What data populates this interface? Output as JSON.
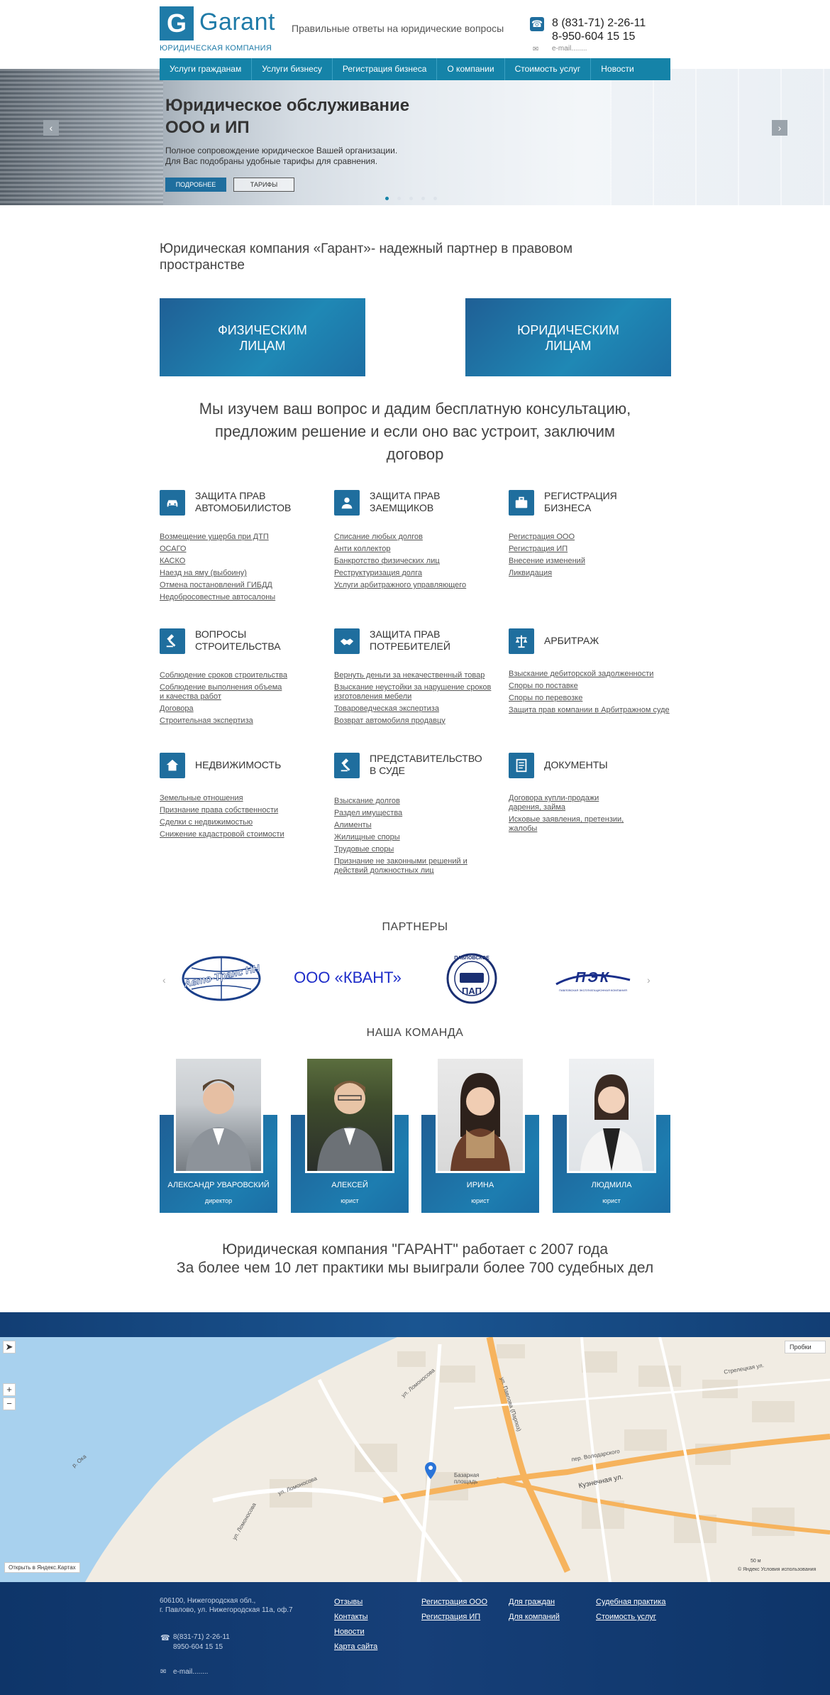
{
  "header": {
    "logo_letter": "G",
    "logo_word": "Garant",
    "logo_sub": "ЮРИДИЧЕСКАЯ КОМПАНИЯ",
    "tagline": "Правильные ответы на юридические вопросы",
    "phone_icon": "phone-icon",
    "phone1": "8 (831-71) 2-26-11",
    "phone2": "8-950-604 15 15",
    "mail_icon": "mail-icon",
    "email": "e-mail........"
  },
  "nav": [
    "Услуги гражданам",
    "Услуги бизнесу",
    "Регистрация бизнеса",
    "О компании",
    "Стоимость услуг",
    "Новости"
  ],
  "hero": {
    "title_line1": "Юридическое обслуживание",
    "title_line2": "ООО и ИП",
    "desc_line1": "Полное сопровождение юридическое Вашей организации.",
    "desc_line2": "Для Вас подобраны удобные тарифы для сравнения.",
    "btn_more": "ПОДРОБНЕЕ",
    "btn_tariffs": "ТАРИФЫ",
    "prev_icon": "‹",
    "next_icon": "›"
  },
  "intro": "Юридическая компания «Гарант»- надежный партнер в правовом пространстве",
  "big_buttons": {
    "individuals_line1": "ФИЗИЧЕСКИМ",
    "individuals_line2": "ЛИЦАМ",
    "legal_line1": "ЮРИДИЧЕСКИМ",
    "legal_line2": "ЛИЦАМ"
  },
  "consult": {
    "line1": "Мы изучем ваш вопрос и дадим бесплатную консультацию,",
    "line2": "предложим решение и если оно вас устроит, заключим",
    "line3": "договор"
  },
  "services": [
    {
      "icon": "car-icon",
      "title_line1": "ЗАЩИТА ПРАВ",
      "title_line2": "АВТОМОБИЛИСТОВ",
      "links": [
        "Возмещение ущерба при ДТП",
        "ОСАГО",
        "КАСКО",
        "Наезд на яму (выбоину)",
        "Отмена постановлений ГИБДД",
        "Недобросовестные автосалоны"
      ]
    },
    {
      "icon": "borrower-icon",
      "title_line1": "ЗАЩИТА ПРАВ",
      "title_line2": "ЗАЕМЩИКОВ",
      "links": [
        "Списание любых долгов",
        "Анти коллектор",
        "Банкротство физических лиц",
        "Реструктуризация долга",
        "Услуги арбитражного управляющего"
      ]
    },
    {
      "icon": "briefcase-icon",
      "title_line1": "РЕГИСТРАЦИЯ",
      "title_line2": "БИЗНЕСА",
      "links": [
        "Регистрация ООО",
        "Регистрация ИП",
        "Внесение изменений",
        "Ликвидация"
      ]
    },
    {
      "icon": "hammer-icon",
      "title_line1": "ВОПРОСЫ",
      "title_line2": "СТРОИТЕЛЬСТВА",
      "links": [
        "Соблюдение сроков строительства",
        "Соблюдение выполнения объема",
        "и качества работ",
        "Договора",
        "Строительная экспертиза"
      ]
    },
    {
      "icon": "handshake-icon",
      "title_line1": "ЗАЩИТА ПРАВ",
      "title_line2": "ПОТРЕБИТЕЛЕЙ",
      "links": [
        "Вернуть деньги за некачественный товар",
        "Взыскание неустойки за нарушение сроков",
        "изготовления мебели",
        "Товароведческая экспертиза",
        "Возврат автомобиля продавцу"
      ]
    },
    {
      "icon": "scales-icon",
      "title_line1": "АРБИТРАЖ",
      "title_line2": "",
      "links": [
        "Взыскание дебиторской задолженности",
        "Споры по поставке",
        "Споры по перевозке",
        "Защита прав компании в Арбитражном суде"
      ]
    },
    {
      "icon": "house-icon",
      "title_line1": "НЕДВИЖИМОСТЬ",
      "title_line2": "",
      "links": [
        "Земельные отношения",
        "Признание права собственности",
        "Сделки с недвижимостью",
        "Снижение кадастровой стоимости"
      ]
    },
    {
      "icon": "gavel-icon",
      "title_line1": "ПРЕДСТАВИТЕЛЬСТВО",
      "title_line2": "В СУДЕ",
      "links": [
        "Взыскание долгов",
        "Раздел имущества",
        "Алименты",
        "Жилищные споры",
        "Трудовые споры",
        "Признание не законными решений и",
        "действий должностных лиц"
      ]
    },
    {
      "icon": "document-icon",
      "title_line1": "ДОКУМЕНТЫ",
      "title_line2": "",
      "links": [
        "Договора купли-продажи",
        "дарения, займа",
        "Исковые заявления, претензии,",
        "жалобы"
      ]
    }
  ],
  "partners": {
    "title": "ПАРТНЕРЫ",
    "logo1_text": "Авто-Транс НН",
    "logo2_text": "ООО «КВАНТ»",
    "logo3_text_top": "ПАВЛОВСКОЕ",
    "logo3_text_bottom": "ПАП",
    "logo4_text": "ПЭК",
    "logo4_sub": "ПАВЛОВСКАЯ ЭКСПЛУАТАЦИОННАЯ КОМПАНИЯ",
    "prev_icon": "‹",
    "next_icon": "›"
  },
  "team": {
    "title": "НАША КОМАНДА",
    "members": [
      {
        "name": "АЛЕКСАНДР УВАРОВСКИЙ",
        "role": "директор"
      },
      {
        "name": "АЛЕКСЕЙ",
        "role": "юрист"
      },
      {
        "name": "ИРИНА",
        "role": "юрист"
      },
      {
        "name": "ЛЮДМИЛА",
        "role": "юрист"
      }
    ]
  },
  "stats": {
    "line1": "Юридическая компания \"ГАРАНТ\" работает с 2007 года",
    "line2": "За более чем 10 лет практики мы выиграли более 700 судебных дел"
  },
  "map": {
    "traffic": "Пробки",
    "open_in": "Открыть в Яндекс.Картах",
    "scale": "50 м",
    "copyright": "© Яндекс Условия использования",
    "labels": {
      "lomonosova1": "ул. Ломоносова",
      "lomonosova2": "ул. Ломоносова",
      "lomonosova3": "ул. Ломоносова",
      "pavlova": "ул. Павлова (Парпоз)",
      "kuznechnaya": "Кузнечная ул.",
      "volodarskogo": "пер. Володарского",
      "bazar": "Базарная площадь",
      "oka": "р. Ока",
      "strelets": "Стрелецкая ул."
    }
  },
  "footer": {
    "address_line1": "606100, Нижегородская обл.,",
    "address_line2": "г. Павлово, ул. Нижегородская 11а, оф.7",
    "phone1": "8(831-71) 2-26-11",
    "phone2": "8950-604 15 15",
    "email": "e-mail........",
    "col1": [
      "Отзывы",
      "Контакты",
      "Новости",
      "Карта сайта"
    ],
    "col2": [
      "Регистрация ООО",
      "Регистрация ИП"
    ],
    "col3": [
      "Для граждан",
      "Для компаний"
    ],
    "col4": [
      "Судебная практика",
      "Стоимость услуг"
    ]
  }
}
